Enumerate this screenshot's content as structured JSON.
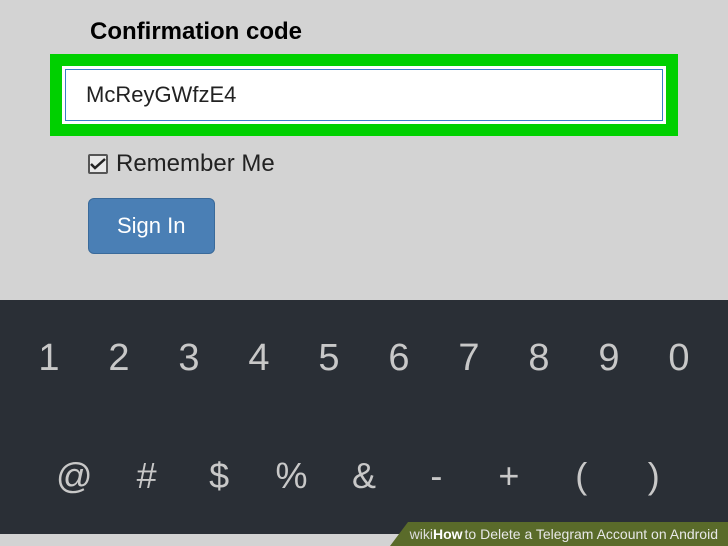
{
  "form": {
    "label": "Confirmation code",
    "code_value": "McReyGWfzE4",
    "remember_label": "Remember Me",
    "remember_checked": true,
    "signin_label": "Sign In"
  },
  "keyboard": {
    "row1": [
      "1",
      "2",
      "3",
      "4",
      "5",
      "6",
      "7",
      "8",
      "9",
      "0"
    ],
    "row2": [
      "@",
      "#",
      "$",
      "%",
      "&",
      "-",
      "+",
      "(",
      ")"
    ]
  },
  "banner": {
    "brand1": "wiki",
    "brand2": "How",
    "text": " to Delete a Telegram Account on Android"
  }
}
